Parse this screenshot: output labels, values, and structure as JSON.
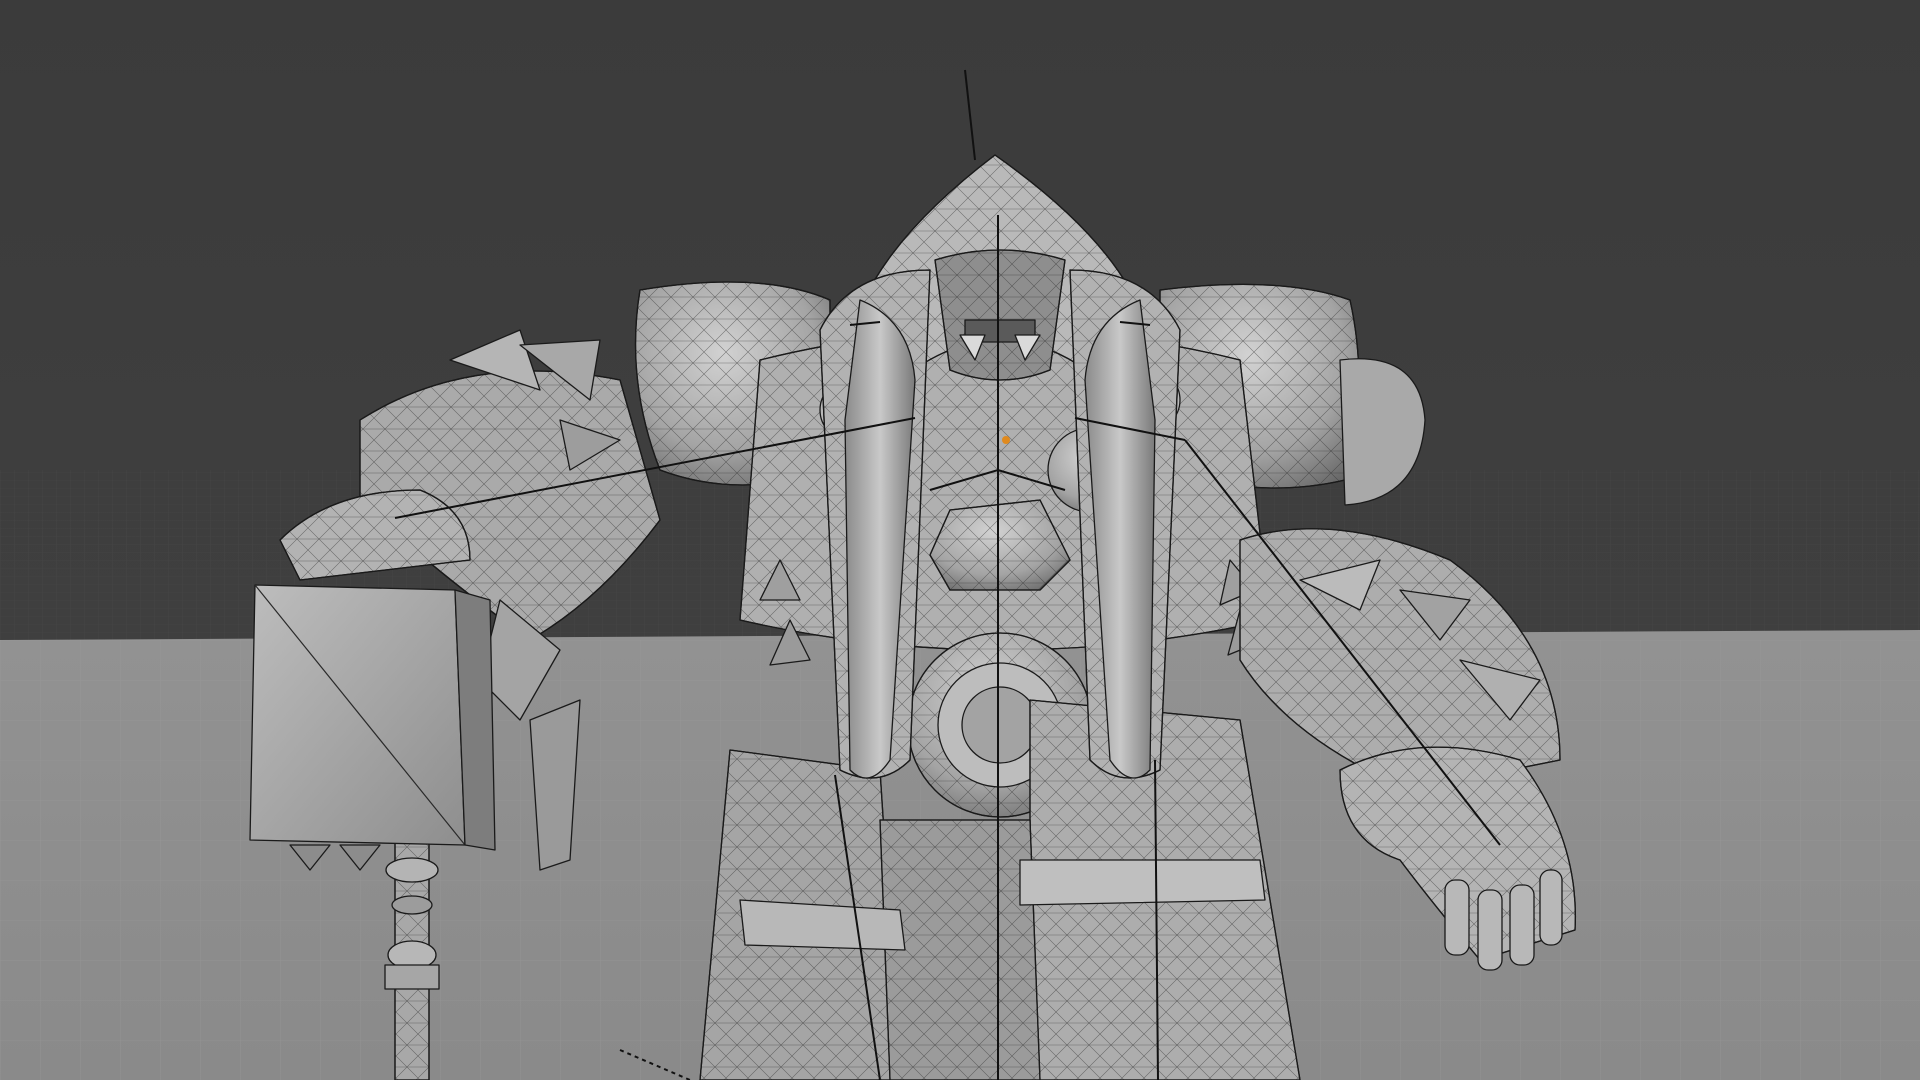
{
  "viewport": {
    "mode": "3d-viewport",
    "shading": "solid",
    "overlays": "wireframe",
    "world_color": "#3d3d3d",
    "floor_color": "#8f8f8f",
    "mesh_color": "#a6a6a6",
    "wire_color": "#1a1a1a",
    "origin_color": "#e08a1e"
  },
  "scene": {
    "object": "armored-ogre-character-mesh",
    "props": [
      "hammer",
      "armature-bones"
    ],
    "grid_visible": true
  }
}
